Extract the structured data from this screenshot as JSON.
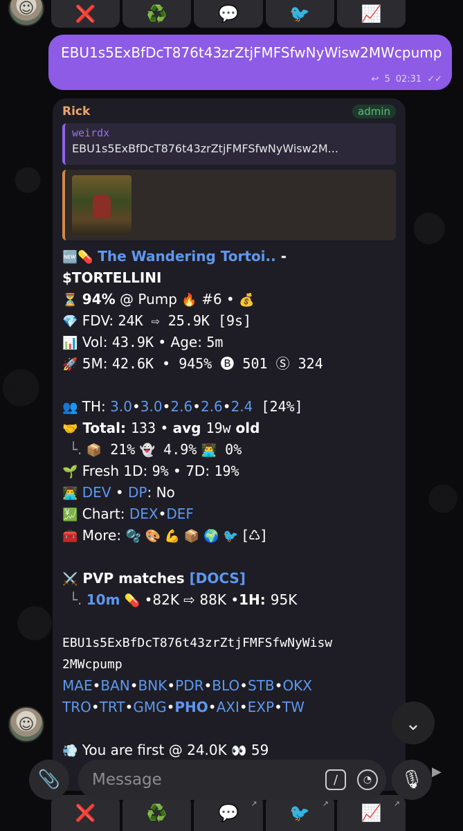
{
  "top_keyboard": [
    {
      "icon": "❌",
      "name": "x-icon"
    },
    {
      "icon": "♻️",
      "name": "recycle-icon"
    },
    {
      "icon": "💬",
      "name": "speech-icon"
    },
    {
      "icon": "🐦",
      "name": "bird-icon"
    },
    {
      "icon": "📈",
      "name": "chart-icon"
    }
  ],
  "bottom_keyboard": [
    {
      "icon": "❌",
      "name": "x-icon"
    },
    {
      "icon": "♻️",
      "name": "recycle-icon"
    },
    {
      "icon": "💬",
      "name": "speech-icon"
    },
    {
      "icon": "🐦",
      "name": "bird-icon"
    },
    {
      "icon": "📈",
      "name": "chart-icon"
    }
  ],
  "outgoing": {
    "text": "EBU1s5ExBfDcT876t43zrZtjFMFSfwNyWisw2MWcpump",
    "reply_icon": "↩",
    "reply_count": "5",
    "time": "02:31",
    "status": "✓✓"
  },
  "incoming": {
    "sender": "Rick",
    "badge": "admin",
    "reply": {
      "name": "weirdx",
      "text": "EBU1s5ExBfDcT876t43zrZtjFMFSfwNyWisw2M..."
    },
    "token_line": {
      "emojis": "🆕💊",
      "name": "The Wandering Tortoi..",
      "dash": " -"
    },
    "ticker": "$TORTELLINI",
    "l_pump": {
      "e1": "⏳",
      "pct": "94%",
      "at": " @ Pump ",
      "e2": "🔥",
      "rank": " #6 • ",
      "e3": "💰"
    },
    "l_fdv": {
      "e": "💎",
      "label": " FDV: ",
      "value": "24K ⇨ 25.9K [9s]"
    },
    "l_vol": {
      "e": "📊",
      "label": " Vol: ",
      "value": "43.9K",
      "sep": " • ",
      "label2": "Age: ",
      "value2": "5m"
    },
    "l_5m": {
      "e": "🚀",
      "label": " 5M: ",
      "value": "42.6K • 945% 🅑 501 Ⓢ 324"
    },
    "l_th": {
      "e": "👥",
      "label": " TH: ",
      "v1": "3.0",
      "v2": "3.0",
      "v3": "2.6",
      "v4": "2.6",
      "v5": "2.4",
      "dot": "•",
      "pct": " [24%]"
    },
    "l_total": {
      "e": "🤝",
      "label": " Total: ",
      "value": "133",
      "sep": " • ",
      "avg": "avg ",
      "avg_val": "19w",
      "old": " old"
    },
    "l_sub": {
      "prefix": "└.",
      "e1": "📦",
      "v1": " 21%",
      "e2": "👻",
      "v2": " 4.9%",
      "e3": "👨‍💻",
      "v3": " 0%"
    },
    "l_fresh": {
      "e": "🌱",
      "label": " Fresh 1D: ",
      "v1": "9%",
      "sep": " • ",
      "label2": "7D: ",
      "v2": "19%"
    },
    "l_dev": {
      "e": "👨‍💻",
      "dev": "DEV",
      "sep": " • ",
      "dp": "DP",
      "value": ": No"
    },
    "l_chart": {
      "e": "💹",
      "label": " Chart: ",
      "l1": "DEX",
      "dot": "•",
      "l2": "DEF"
    },
    "l_more": {
      "e": "🧰",
      "label": " More: ",
      "icons": "🫧 🎨 💪 📦 🌍 🐦",
      "tail": " [♺]"
    },
    "l_pvp": {
      "e": "⚔️",
      "label": " PVP matches ",
      "docs": "[DOCS]"
    },
    "l_10m": {
      "prefix": "└.",
      "time": "10m",
      "e": "💊",
      "value": " •82K ⇨ 88K •",
      "label": "1H: ",
      "value2": "95K"
    },
    "ca_line1": "EBU1s5ExBfDcT876t43zrZtjFMFSfwNyWisw",
    "ca_line2": "2MWcpump",
    "links1": [
      "MAE",
      "BAN",
      "BNK",
      "PDR",
      "BLO",
      "STB",
      "OKX"
    ],
    "links2": [
      "TRO",
      "TRT",
      "GMG",
      "PHO",
      "AXI",
      "EXP",
      "TW"
    ],
    "link_dot": "•",
    "l_first": {
      "e": "💨",
      "label": " You are first @ 24.0K ",
      "e2": "👀",
      "value": " 59"
    }
  },
  "input": {
    "placeholder": "Message",
    "command_icon": "/",
    "sticker_icon": "◔"
  },
  "icons": {
    "scroll_down": "⌄",
    "attach": "📎",
    "mic": "🎙",
    "side_arrow": "▶"
  }
}
